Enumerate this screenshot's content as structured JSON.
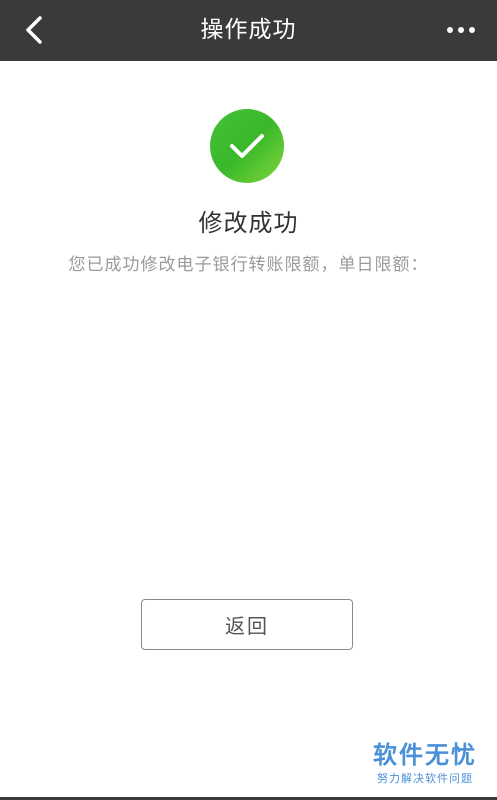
{
  "header": {
    "title": "操作成功",
    "back_icon": "chevron-left-icon",
    "more_icon": "more-horizontal-icon"
  },
  "result": {
    "icon": "check-circle-icon",
    "icon_color": "#45c238",
    "title": "修改成功",
    "description": "您已成功修改电子银行转账限额，单日限额："
  },
  "actions": {
    "return_label": "返回"
  },
  "watermark": {
    "main": "软件无忧",
    "sub": "努力解决软件问题"
  }
}
